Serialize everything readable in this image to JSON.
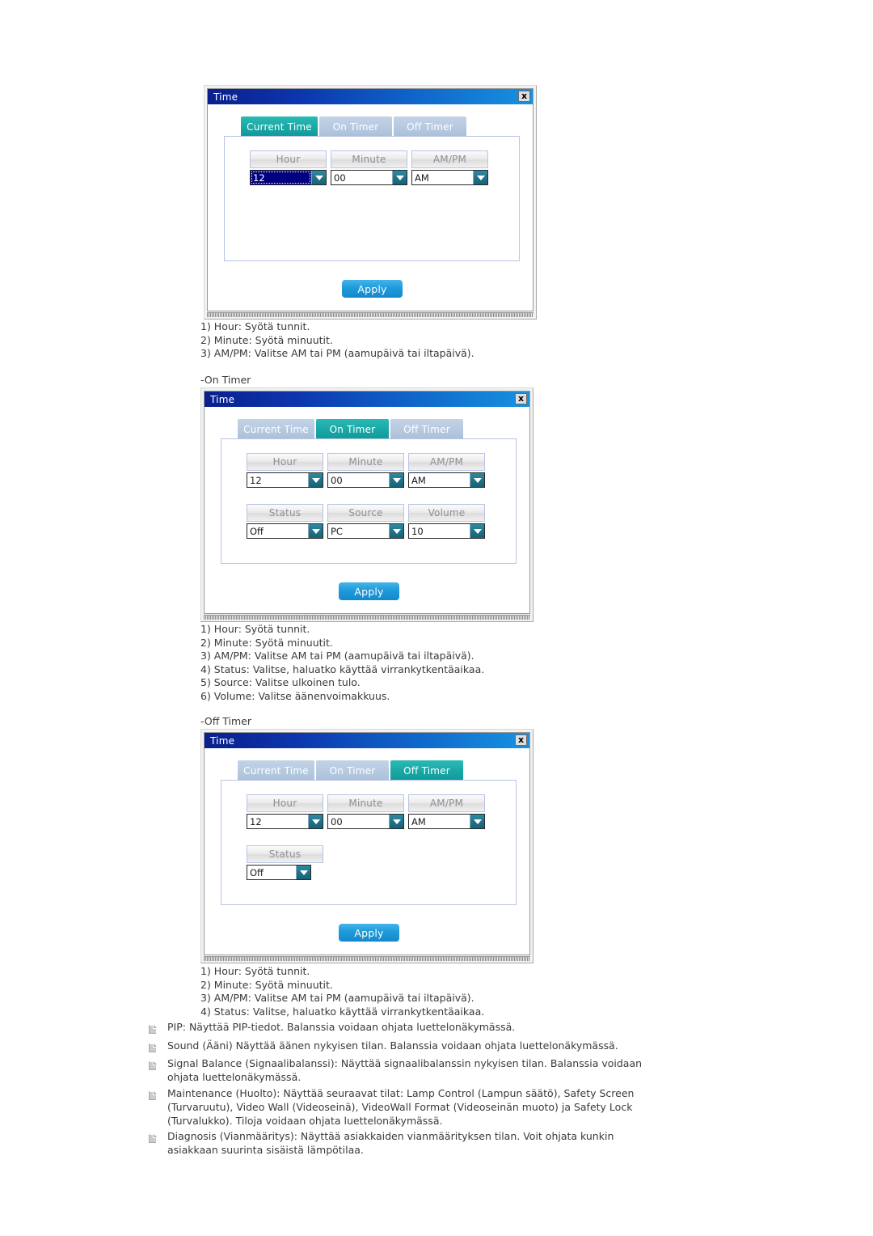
{
  "page": {
    "background": "#ffffff",
    "accent_active_tab": "#17a6a4",
    "accent_apply": "#1f9ada",
    "titlebar_gradient_from": "#0a1f8c",
    "titlebar_gradient_to": "#1792e0",
    "selected_value_bg": "#000080"
  },
  "dialogs": [
    {
      "title": "Time",
      "close_label": "x",
      "tabs": [
        {
          "label": "Current Time",
          "active": true
        },
        {
          "label": "On Timer",
          "active": false
        },
        {
          "label": "Off Timer",
          "active": false
        }
      ],
      "fields_row1": [
        {
          "label": "Hour",
          "value": "12",
          "selected": true
        },
        {
          "label": "Minute",
          "value": "00",
          "selected": false
        },
        {
          "label": "AM/PM",
          "value": "AM",
          "selected": false
        }
      ],
      "fields_row2": [],
      "apply_label": "Apply"
    },
    {
      "title": "Time",
      "close_label": "x",
      "tabs": [
        {
          "label": "Current Time",
          "active": false
        },
        {
          "label": "On Timer",
          "active": true
        },
        {
          "label": "Off Timer",
          "active": false
        }
      ],
      "fields_row1": [
        {
          "label": "Hour",
          "value": "12",
          "selected": false
        },
        {
          "label": "Minute",
          "value": "00",
          "selected": false
        },
        {
          "label": "AM/PM",
          "value": "AM",
          "selected": false
        }
      ],
      "fields_row2": [
        {
          "label": "Status",
          "value": "Off",
          "selected": false
        },
        {
          "label": "Source",
          "value": "PC",
          "selected": false
        },
        {
          "label": "Volume",
          "value": "10",
          "selected": false
        }
      ],
      "apply_label": "Apply"
    },
    {
      "title": "Time",
      "close_label": "x",
      "tabs": [
        {
          "label": "Current Time",
          "active": false
        },
        {
          "label": "On Timer",
          "active": false
        },
        {
          "label": "Off Timer",
          "active": true
        }
      ],
      "fields_row1": [
        {
          "label": "Hour",
          "value": "12",
          "selected": false
        },
        {
          "label": "Minute",
          "value": "00",
          "selected": false
        },
        {
          "label": "AM/PM",
          "value": "AM",
          "selected": false
        }
      ],
      "fields_row2": [
        {
          "label": "Status",
          "value": "Off",
          "selected": false
        }
      ],
      "apply_label": "Apply"
    }
  ],
  "notes_current_time": [
    "1) Hour: Syötä tunnit.",
    "2) Minute: Syötä minuutit.",
    "3) AM/PM: Valitse AM tai PM (aamupäivä tai iltapäivä)."
  ],
  "heading_on_timer": "-On Timer",
  "notes_on_timer": [
    "1) Hour: Syötä tunnit.",
    "2) Minute: Syötä minuutit.",
    "3) AM/PM: Valitse AM tai PM (aamupäivä tai iltapäivä).",
    "4) Status: Valitse, haluatko käyttää virrankytkentäaikaa.",
    "5) Source: Valitse ulkoinen tulo.",
    "6) Volume: Valitse äänenvoimakkuus."
  ],
  "heading_off_timer": "-Off Timer",
  "notes_off_timer": [
    "1) Hour: Syötä tunnit.",
    "2) Minute: Syötä minuutit.",
    "3) AM/PM: Valitse AM tai PM (aamupäivä tai iltapäivä).",
    "4) Status: Valitse, haluatko käyttää virrankytkentäaikaa."
  ],
  "bullets": [
    "PIP: Näyttää PIP-tiedot. Balanssia voidaan ohjata luettelonäkymässä.",
    "Sound (Ääni) Näyttää äänen nykyisen tilan. Balanssia voidaan ohjata luettelonäkymässä.",
    "Signal Balance (Signaalibalanssi): Näyttää signaalibalanssin nykyisen tilan. Balanssia voidaan\nohjata luettelonäkymässä.",
    "Maintenance (Huolto): Näyttää seuraavat tilat: Lamp Control (Lampun säätö), Safety Screen\n(Turvaruutu), Video Wall (Videoseinä), VideoWall Format (Videoseinän muoto) ja Safety Lock\n(Turvalukko). Tiloja voidaan ohjata luettelonäkymässä.",
    "Diagnosis (Vianmääritys): Näyttää asiakkaiden vianmäärityksen tilan. Voit ohjata kunkin\nasiakkaan suurinta sisäistä lämpötilaa."
  ]
}
